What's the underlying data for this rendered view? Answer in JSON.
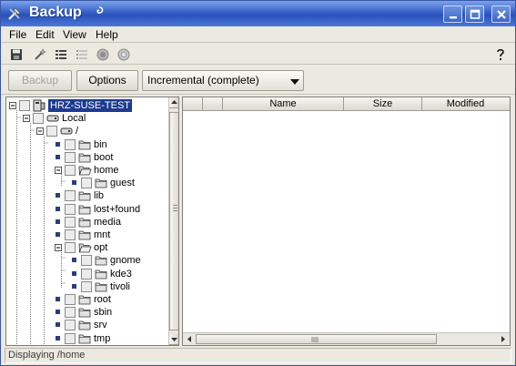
{
  "window": {
    "title": "Backup",
    "controls": [
      "minimize",
      "maximize",
      "close"
    ]
  },
  "menu": [
    "File",
    "Edit",
    "View",
    "Help"
  ],
  "toolbar_icons": [
    "save-disk-icon",
    "wand-icon",
    "list-detail-icon",
    "list-simple-icon",
    "record-circle-icon",
    "stop-circle-icon",
    "help-question-icon"
  ],
  "actions": {
    "backup_label": "Backup",
    "backup_enabled": false,
    "options_label": "Options",
    "mode_selected": "Incremental (complete)"
  },
  "tree": {
    "nodes": [
      {
        "label": "HRZ-SUSE-TEST",
        "type": "computer",
        "expanded": true,
        "selected": true
      },
      {
        "label": "Local",
        "type": "drive",
        "expanded": true
      },
      {
        "label": "/",
        "type": "drive",
        "expanded": true
      },
      {
        "label": "bin",
        "type": "folder",
        "expanded": false
      },
      {
        "label": "boot",
        "type": "folder",
        "expanded": false
      },
      {
        "label": "home",
        "type": "folder-open",
        "expanded": true
      },
      {
        "label": "guest",
        "type": "folder",
        "expanded": false
      },
      {
        "label": "lib",
        "type": "folder",
        "expanded": false
      },
      {
        "label": "lost+found",
        "type": "folder",
        "expanded": false
      },
      {
        "label": "media",
        "type": "folder",
        "expanded": false
      },
      {
        "label": "mnt",
        "type": "folder",
        "expanded": false
      },
      {
        "label": "opt",
        "type": "folder-open",
        "expanded": true
      },
      {
        "label": "gnome",
        "type": "folder",
        "expanded": false
      },
      {
        "label": "kde3",
        "type": "folder",
        "expanded": false
      },
      {
        "label": "tivoli",
        "type": "folder",
        "expanded": false
      },
      {
        "label": "root",
        "type": "folder",
        "expanded": false
      },
      {
        "label": "sbin",
        "type": "folder",
        "expanded": false
      },
      {
        "label": "srv",
        "type": "folder",
        "expanded": false
      },
      {
        "label": "tmp",
        "type": "folder",
        "expanded": false
      }
    ]
  },
  "file_list": {
    "columns": [
      "",
      "",
      "Name",
      "Size",
      "Modified"
    ],
    "rows": []
  },
  "status": "Displaying /home"
}
